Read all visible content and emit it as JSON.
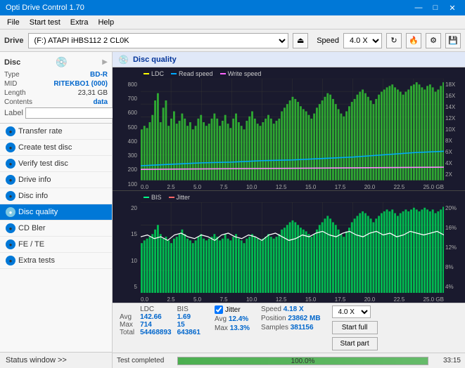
{
  "titlebar": {
    "title": "Opti Drive Control 1.70",
    "minimize": "—",
    "maximize": "□",
    "close": "✕"
  },
  "menubar": {
    "items": [
      "File",
      "Start test",
      "Extra",
      "Help"
    ]
  },
  "toolbar": {
    "drive_label": "Drive",
    "drive_value": "(F:)  ATAPI iHBS112  2 CL0K",
    "speed_label": "Speed",
    "speed_value": "4.0 X"
  },
  "disc": {
    "section_label": "Disc",
    "type_label": "Type",
    "type_value": "BD-R",
    "mid_label": "MID",
    "mid_value": "RITEKBO1 (000)",
    "length_label": "Length",
    "length_value": "23,31 GB",
    "contents_label": "Contents",
    "contents_value": "data",
    "label_label": "Label",
    "label_value": ""
  },
  "nav": {
    "items": [
      {
        "label": "Transfer rate",
        "active": false
      },
      {
        "label": "Create test disc",
        "active": false
      },
      {
        "label": "Verify test disc",
        "active": false
      },
      {
        "label": "Drive info",
        "active": false
      },
      {
        "label": "Disc info",
        "active": false
      },
      {
        "label": "Disc quality",
        "active": true
      },
      {
        "label": "CD Bler",
        "active": false
      },
      {
        "label": "FE / TE",
        "active": false
      },
      {
        "label": "Extra tests",
        "active": false
      }
    ],
    "status_window": "Status window >>"
  },
  "disc_quality": {
    "title": "Disc quality",
    "legend": {
      "ldc_label": "LDC",
      "ldc_color": "#ffff00",
      "read_label": "Read speed",
      "read_color": "#00aaff",
      "write_label": "Write speed",
      "write_color": "#ff66ff"
    },
    "chart1": {
      "y_labels": [
        "800",
        "700",
        "600",
        "500",
        "400",
        "300",
        "200",
        "100"
      ],
      "y_right": [
        "18X",
        "16X",
        "14X",
        "12X",
        "10X",
        "8X",
        "6X",
        "4X",
        "2X"
      ],
      "x_labels": [
        "0.0",
        "2.5",
        "5.0",
        "7.5",
        "10.0",
        "12.5",
        "15.0",
        "17.5",
        "20.0",
        "22.5",
        "25.0 GB"
      ]
    },
    "chart2": {
      "legend_bis": "BIS",
      "legend_bis_color": "#00ff88",
      "legend_jitter": "Jitter",
      "legend_jitter_color": "#ff6666",
      "y_labels": [
        "20",
        "15",
        "10",
        "5"
      ],
      "y_right": [
        "20%",
        "16%",
        "12%",
        "8%",
        "4%"
      ],
      "x_labels": [
        "0.0",
        "2.5",
        "5.0",
        "7.5",
        "10.0",
        "12.5",
        "15.0",
        "17.5",
        "20.0",
        "22.5",
        "25.0 GB"
      ]
    }
  },
  "stats": {
    "headers": [
      "",
      "LDC",
      "BIS"
    ],
    "avg_label": "Avg",
    "avg_ldc": "142.66",
    "avg_bis": "1.69",
    "max_label": "Max",
    "max_ldc": "714",
    "max_bis": "15",
    "total_label": "Total",
    "total_ldc": "54468893",
    "total_bis": "643861",
    "jitter_label": "Jitter",
    "jitter_checked": true,
    "jitter_avg": "12.4%",
    "jitter_max": "13.3%",
    "speed_label": "Speed",
    "speed_value": "4.18 X",
    "speed_target": "4.0 X",
    "position_label": "Position",
    "position_value": "23862 MB",
    "samples_label": "Samples",
    "samples_value": "381156",
    "btn_start_full": "Start full",
    "btn_start_part": "Start part"
  },
  "status": {
    "text": "Test completed",
    "progress": 100,
    "progress_text": "100.0%",
    "time": "33:15"
  }
}
